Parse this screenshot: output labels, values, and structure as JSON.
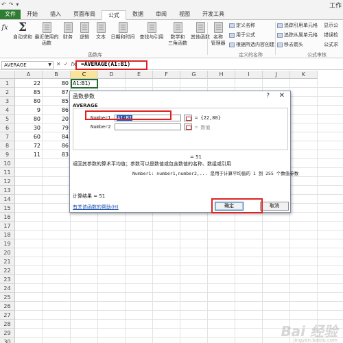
{
  "window": {
    "title": "工作"
  },
  "quick_access": [
    "↶",
    "↷",
    "▾"
  ],
  "ribbon_tabs": [
    "文件",
    "开始",
    "插入",
    "页面布局",
    "公式",
    "数据",
    "审阅",
    "视图",
    "开发工具"
  ],
  "ribbon": {
    "insert_fn_label": "fx",
    "buttons": [
      {
        "label": "自动求和"
      },
      {
        "label": "最近使用的\n函数"
      },
      {
        "label": "财务"
      },
      {
        "label": "逻辑"
      },
      {
        "label": "文本"
      },
      {
        "label": "日期和时间"
      },
      {
        "label": "查找与引用"
      },
      {
        "label": "数学和\n三角函数"
      },
      {
        "label": "其他函数"
      },
      {
        "label": "名称\n管理器"
      }
    ],
    "library_group_label": "函数库",
    "names_items": [
      "定义名称",
      "用于公式",
      "根据所选内容创建"
    ],
    "names_group_label": "定义的名称",
    "audit_items": [
      "追踪引用单元格",
      "追踪从属单元格",
      "移去箭头"
    ],
    "audit_right": [
      "显示公",
      "错误检",
      "公式求"
    ],
    "audit_group_label": "公式审核"
  },
  "formula_bar": {
    "name_box": "AVERAGE",
    "icons": [
      "✕",
      "✓",
      "fx"
    ],
    "formula": "=AVERAGE(A1:B1)"
  },
  "grid": {
    "columns": [
      "A",
      "B",
      "C",
      "D",
      "E",
      "F",
      "G",
      "H",
      "I",
      "J",
      "K"
    ],
    "selected_column": "C",
    "rows": [
      "1",
      "2",
      "3",
      "4",
      "5",
      "6",
      "7",
      "8",
      "9",
      "10",
      "11",
      "12",
      "13",
      "14",
      "15",
      "16",
      "17",
      "18",
      "19",
      "20",
      "21",
      "22",
      "23",
      "24",
      "25",
      "26",
      "27",
      "28",
      "29",
      "30"
    ],
    "data": [
      [
        "22",
        "80"
      ],
      [
        "85",
        "87"
      ],
      [
        "80",
        "85"
      ],
      [
        "9",
        "86"
      ],
      [
        "80",
        "20"
      ],
      [
        "30",
        "79"
      ],
      [
        "60",
        "84"
      ],
      [
        "72",
        "86"
      ],
      [
        "11",
        "83"
      ]
    ],
    "active_cell_text": "A1:B1)"
  },
  "dialog": {
    "title": "函数参数",
    "help_glyph": "?",
    "close_glyph": "✕",
    "function_name": "AVERAGE",
    "arg1_label": "Number1",
    "arg1_value": "A1:B1",
    "arg1_result": "= {22,80}",
    "arg2_label": "Number2",
    "arg2_value": "",
    "arg2_result": "= 数值",
    "result_line": "= 51",
    "description": "返回其参数的算术平均值；参数可以是数值或包含数值的名称、数组或引用",
    "arg_description": "Number1:  number1,number2,... 是用于计算平均值的 1 到 255 个数值参数",
    "calc_result": "计算结果 = 51",
    "help_link": "有关该函数的帮助(H)",
    "ok_label": "确定",
    "cancel_label": "取消"
  },
  "watermark": {
    "main": "Bai 经验",
    "sub": "jingyan.baidu.com"
  },
  "colors": {
    "accent": "#1d6e2e",
    "highlight": "#e02020",
    "selection": "#1e5fbf"
  }
}
